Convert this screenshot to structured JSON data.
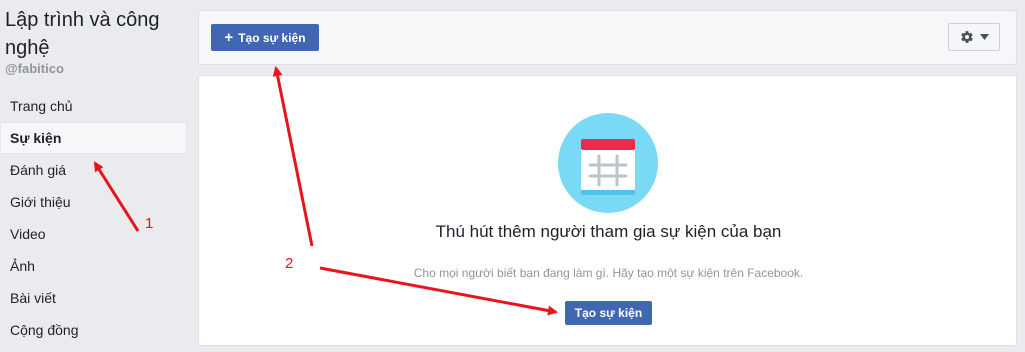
{
  "sidebar": {
    "page_name": "Lập trình và công nghệ",
    "handle": "@fabitico",
    "items": [
      {
        "label": "Trang chủ"
      },
      {
        "label": "Sự kiện"
      },
      {
        "label": "Đánh giá"
      },
      {
        "label": "Giới thiệu"
      },
      {
        "label": "Video"
      },
      {
        "label": "Ảnh"
      },
      {
        "label": "Bài viết"
      },
      {
        "label": "Cộng đồng"
      }
    ],
    "active_item": "Sự kiện"
  },
  "toolbar": {
    "create_event_label": "Tạo sự kiện",
    "plus_icon": "+",
    "settings_icon": "gear-icon"
  },
  "main": {
    "illustration": "calendar-icon",
    "heading": "Thú hút thêm người tham gia sự kiện của bạn",
    "subtext": "Cho mọi người biết bạn đang làm gì. Hãy tạo một sự kiện trên Facebook.",
    "create_event_label": "Tạo sự kiện"
  },
  "annotations": {
    "label_1": "1",
    "label_2": "2",
    "arrow_color": "#e8141b"
  },
  "colors": {
    "brand_blue": "#4267b2",
    "illustration_circle": "#7ad9f5",
    "calendar_top": "#f02849"
  }
}
